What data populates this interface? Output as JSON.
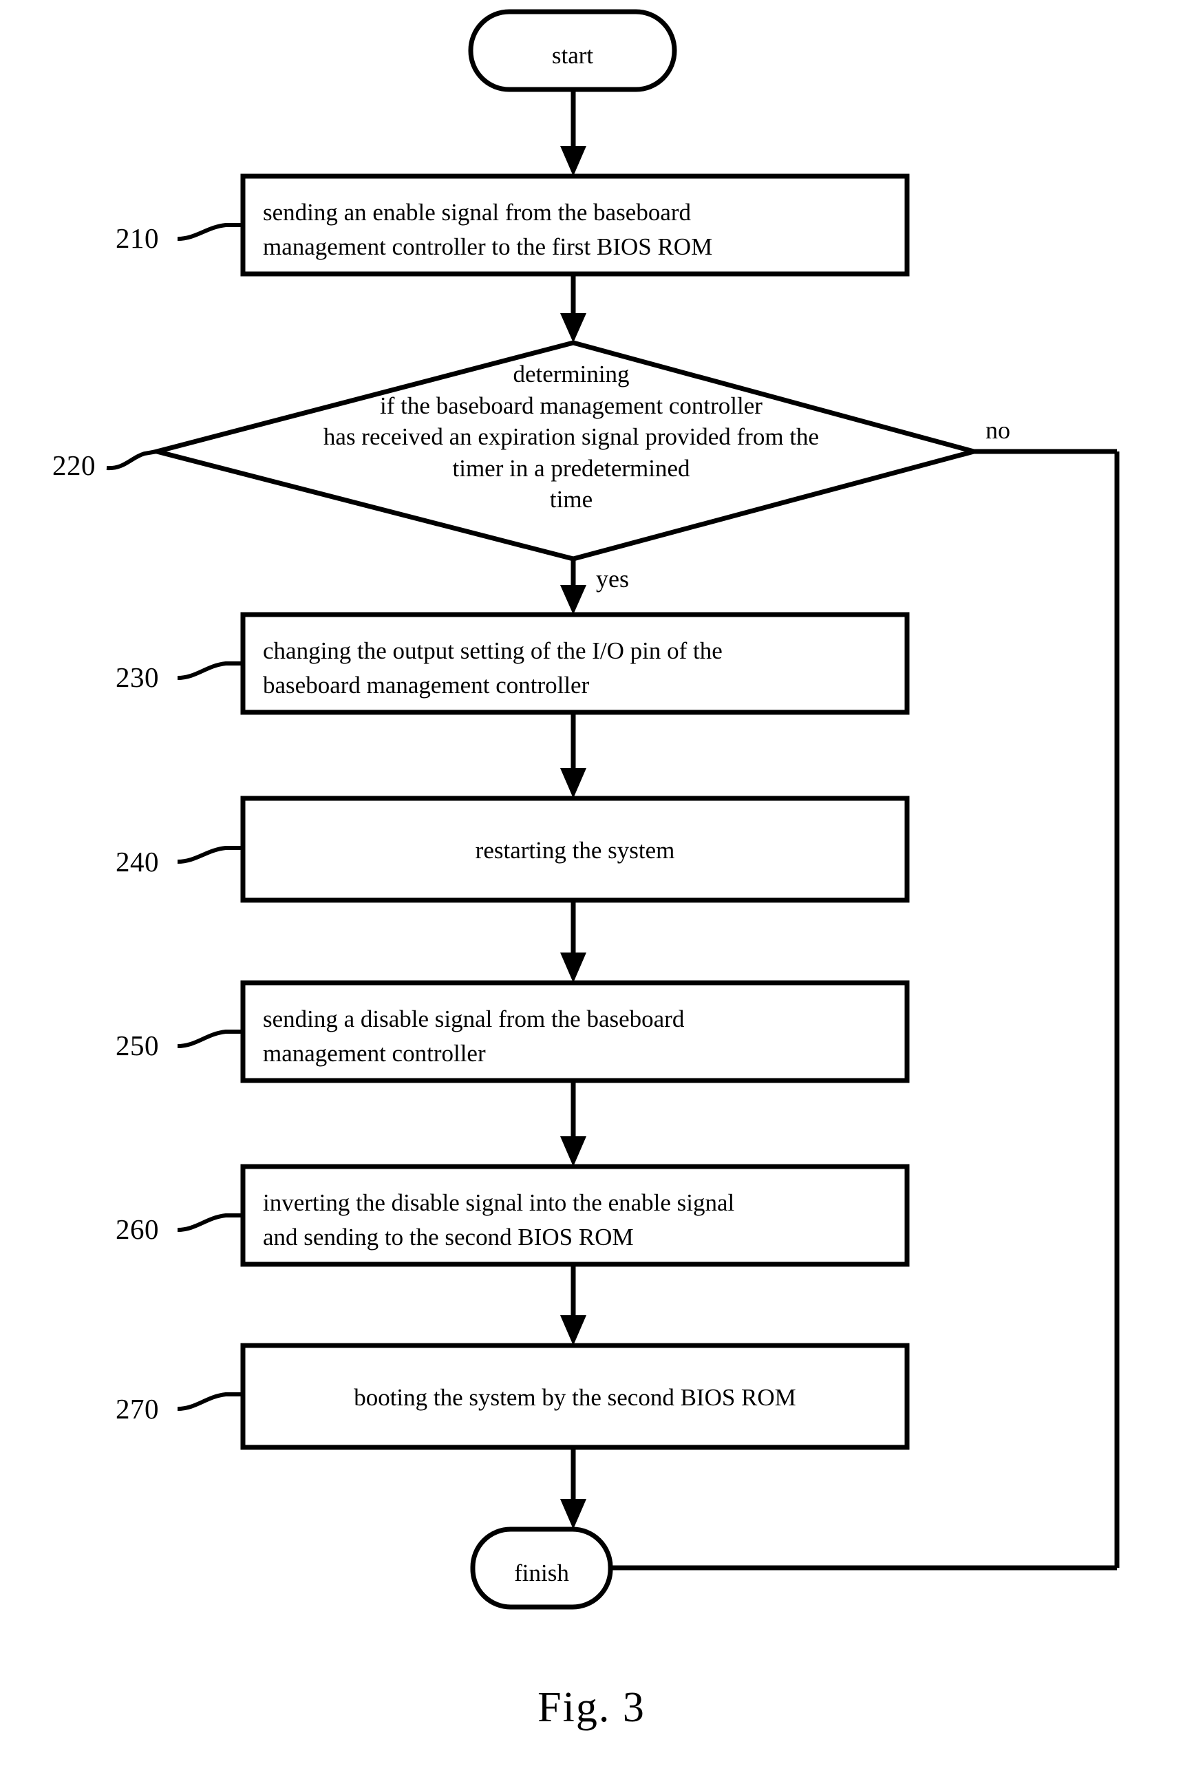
{
  "figure": {
    "caption": "Fig. 3",
    "type": "flowchart"
  },
  "nodes": {
    "start": {
      "id": "start",
      "shape": "terminal",
      "label": "start"
    },
    "step210": {
      "id": "210",
      "shape": "process",
      "ref": "210",
      "label": "sending an enable signal from the baseboard\nmanagement controller to the first BIOS ROM"
    },
    "step220": {
      "id": "220",
      "shape": "decision",
      "ref": "220",
      "label": "determining\nif the baseboard management controller\nhas received an expiration signal provided from the\ntimer in a predetermined\ntime"
    },
    "step230": {
      "id": "230",
      "shape": "process",
      "ref": "230",
      "label": "changing the output setting of the I/O pin of the\nbaseboard management controller"
    },
    "step240": {
      "id": "240",
      "shape": "process",
      "ref": "240",
      "label": "restarting the system"
    },
    "step250": {
      "id": "250",
      "shape": "process",
      "ref": "250",
      "label": "sending a disable signal from the baseboard\nmanagement controller"
    },
    "step260": {
      "id": "260",
      "shape": "process",
      "ref": "260",
      "label": "inverting the disable signal into the enable signal\nand sending to the second BIOS ROM"
    },
    "step270": {
      "id": "270",
      "shape": "process",
      "ref": "270",
      "label": "booting the system by the second BIOS ROM"
    },
    "finish": {
      "id": "finish",
      "shape": "terminal",
      "label": "finish"
    }
  },
  "edges": {
    "yes_label": "yes",
    "no_label": "no"
  },
  "colors": {
    "stroke": "#000000",
    "background": "#ffffff"
  }
}
